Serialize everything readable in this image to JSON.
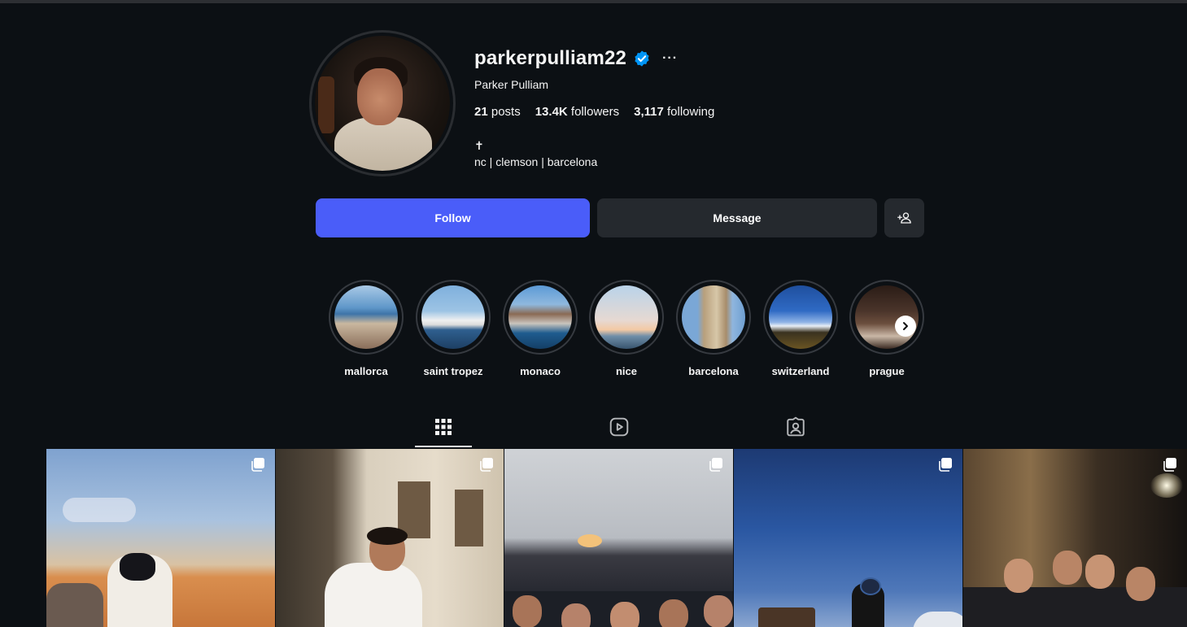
{
  "profile": {
    "username": "parkerpulliam22",
    "full_name": "Parker Pulliam",
    "more_options": "···",
    "stats": {
      "posts_count": "21",
      "posts_label": "posts",
      "followers_count": "13.4K",
      "followers_label": "followers",
      "following_count": "3,117",
      "following_label": "following"
    },
    "bio_line1": "✝",
    "bio_line2": "nc | clemson | barcelona"
  },
  "actions": {
    "follow_label": "Follow",
    "message_label": "Message"
  },
  "highlights": [
    {
      "label": "mallorca"
    },
    {
      "label": "saint tropez"
    },
    {
      "label": "monaco"
    },
    {
      "label": "nice"
    },
    {
      "label": "barcelona"
    },
    {
      "label": "switzerland"
    },
    {
      "label": "prague"
    }
  ],
  "tabs": [
    {
      "icon": "grid-icon",
      "active": true
    },
    {
      "icon": "reels-icon",
      "active": false
    },
    {
      "icon": "tagged-icon",
      "active": false
    }
  ],
  "colors": {
    "background": "#0c1014",
    "follow_button": "#4a5df9",
    "secondary_button": "#25292e",
    "verified_badge": "#0095f6"
  }
}
